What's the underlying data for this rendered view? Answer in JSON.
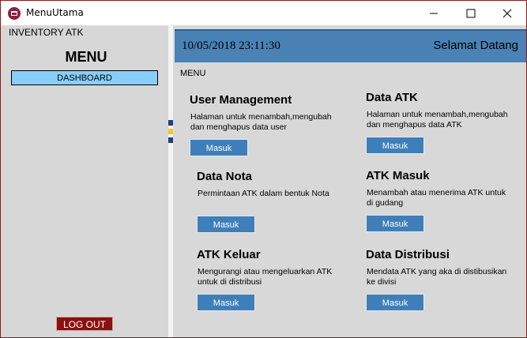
{
  "window": {
    "title": "MenuUtama"
  },
  "sidebar": {
    "app_label": "INVENTORY ATK",
    "menu_title": "MENU",
    "dashboard_label": "DASHBOARD",
    "logout_label": "LOG OUT"
  },
  "header": {
    "datetime": "10/05/2018 23:11:30",
    "welcome": "Selamat Datang"
  },
  "main": {
    "section_label": "MENU",
    "cards": [
      {
        "title": "User Management",
        "desc": "Halaman untuk menambah,mengubah dan menghapus data user",
        "button": "Masuk"
      },
      {
        "title": "Data ATK",
        "desc": "Halaman untuk menambah,mengubah dan menghapus data ATK",
        "button": "Masuk"
      },
      {
        "title": "Data Nota",
        "desc": "Permintaan ATK dalam bentuk Nota",
        "button": "Masuk"
      },
      {
        "title": "ATK Masuk",
        "desc": "Menambah atau menerima ATK untuk di gudang",
        "button": "Masuk"
      },
      {
        "title": "ATK Keluar",
        "desc": "Mengurangi atau mengeluarkan ATK untuk di distribusi",
        "button": "Masuk"
      },
      {
        "title": "Data Distribusi",
        "desc": "Mendata ATK yang aka di distibusikan ke divisi",
        "button": "Masuk"
      }
    ]
  },
  "colors": {
    "header_blue": "#4a82b6",
    "button_blue": "#3f7fb9",
    "dashboard_blue": "#87cefa",
    "logout_red": "#8b1010"
  },
  "icons": [
    "app-icon",
    "minimize-icon",
    "maximize-icon",
    "close-icon"
  ]
}
